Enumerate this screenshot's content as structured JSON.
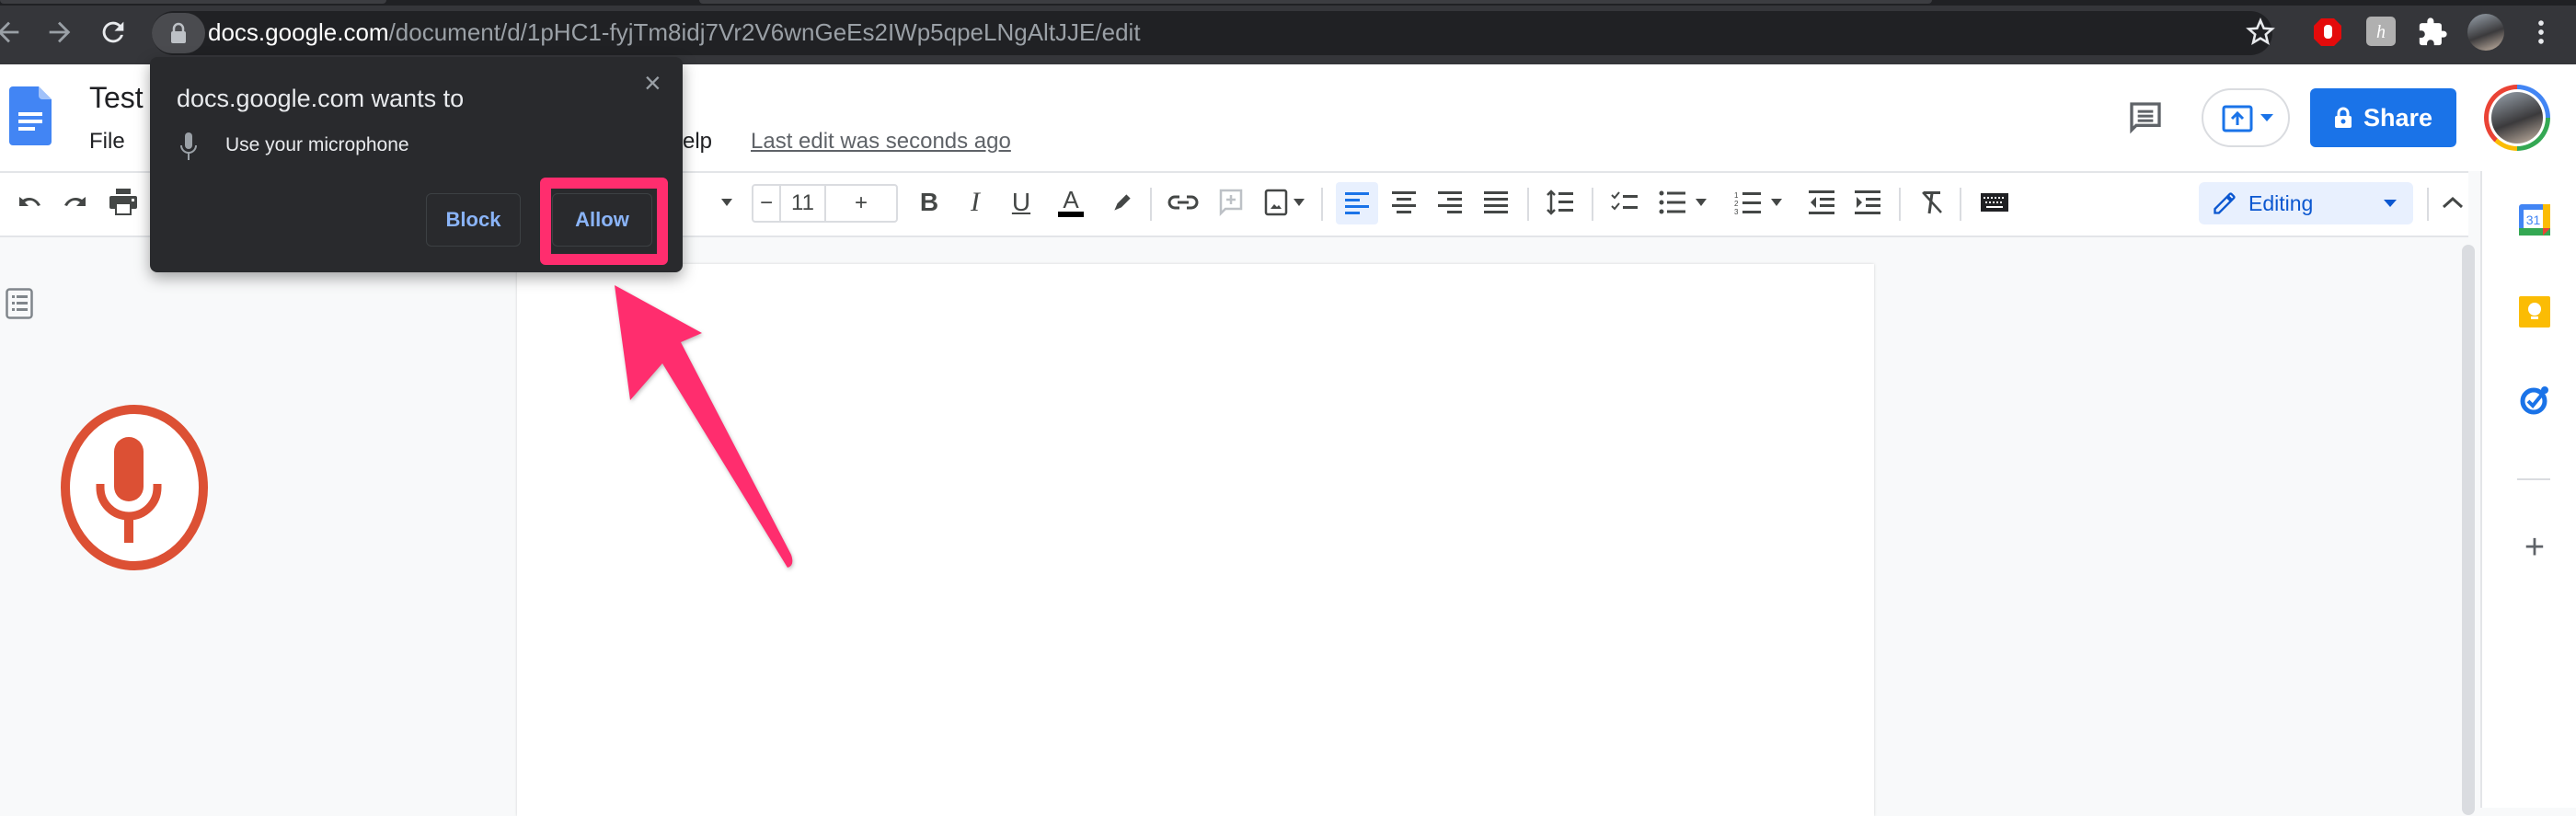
{
  "browser": {
    "url_host": "docs.google.com",
    "url_path": "/document/d/1pHC1-fyjTm8idj7Vr2V6wnGeEs2IWp5qpeLNgAltJJE/edit",
    "nav": {
      "back_icon": "arrow-left-icon",
      "forward_icon": "arrow-right-icon",
      "reload_icon": "reload-icon"
    },
    "extensions": [
      "adblock-icon",
      "honey-icon",
      "extensions-puzzle-icon",
      "profile-avatar",
      "more-vert-icon"
    ]
  },
  "docs": {
    "title": "Test",
    "menu": [
      "File",
      "Help"
    ],
    "menu_help_partial": "elp",
    "last_edit": "Last edit was seconds ago",
    "share_label": "Share",
    "font_size": "11",
    "font_minus": "−",
    "font_plus": "+",
    "editing_mode": "Editing",
    "accent_color": "#1a73e8"
  },
  "permission_dialog": {
    "title": "docs.google.com wants to",
    "permission": "Use your microphone",
    "block_label": "Block",
    "allow_label": "Allow",
    "close_label": "×"
  },
  "annotation": {
    "highlight_color": "#ff2d6e",
    "target": "Allow"
  },
  "side_panel": {
    "apps": [
      "calendar-icon",
      "keep-icon",
      "tasks-icon"
    ],
    "calendar_day": "31",
    "add_label": "+"
  }
}
